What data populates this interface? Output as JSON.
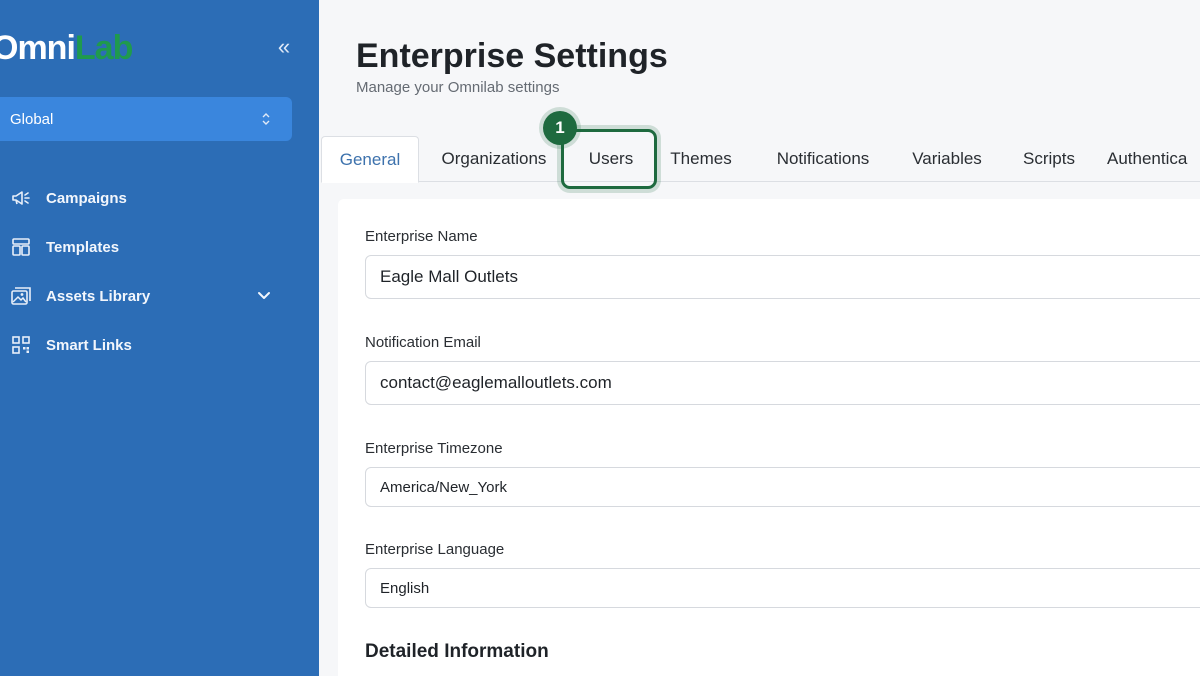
{
  "brand": {
    "part1": "Omni",
    "part2": "Lab"
  },
  "sidebar": {
    "scope_select": {
      "value": "Global"
    },
    "items": [
      {
        "label": "Campaigns",
        "icon": "megaphone-icon"
      },
      {
        "label": "Templates",
        "icon": "template-icon"
      },
      {
        "label": "Assets Library",
        "icon": "images-icon",
        "expandable": true
      },
      {
        "label": "Smart Links",
        "icon": "qr-code-icon"
      }
    ]
  },
  "header": {
    "title": "Enterprise Settings",
    "subtitle": "Manage your Omnilab settings"
  },
  "tabs": [
    {
      "label": "General",
      "active": true
    },
    {
      "label": "Organizations"
    },
    {
      "label": "Users",
      "highlighted": true
    },
    {
      "label": "Themes"
    },
    {
      "label": "Notifications"
    },
    {
      "label": "Variables"
    },
    {
      "label": "Scripts"
    },
    {
      "label": "Authentica"
    }
  ],
  "step_badge": "1",
  "form": {
    "enterprise_name": {
      "label": "Enterprise Name",
      "value": "Eagle Mall Outlets"
    },
    "notification_email": {
      "label": "Notification Email",
      "value": "contact@eaglemalloutlets.com"
    },
    "timezone": {
      "label": "Enterprise Timezone",
      "value": "America/New_York"
    },
    "language": {
      "label": "Enterprise Language",
      "value": "English"
    },
    "section_heading": "Detailed Information"
  },
  "colors": {
    "sidebar_bg": "#2c6db6",
    "scope_bg": "#3a86dd",
    "brand_green": "#1f9a4e",
    "highlight_green": "#1e6a3f",
    "active_tab_text": "#3d72ad"
  }
}
